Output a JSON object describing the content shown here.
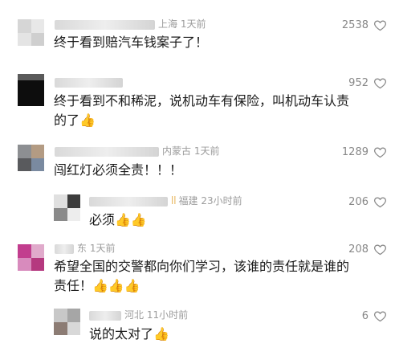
{
  "comments": [
    {
      "location": "上海",
      "time": "1天前",
      "text": [
        "终于看到赔汽车钱案子了！"
      ],
      "likes": "2538"
    },
    {
      "location": "",
      "time": "",
      "text": [
        "终于看到不和稀泥，说机动车有保险，叫机动车认责",
        "的了👍"
      ],
      "likes": "952"
    },
    {
      "location": "内蒙古",
      "time": "1天前",
      "text": [
        "闯红灯必须全责！！！"
      ],
      "likes": "1289"
    },
    {
      "location": "福建",
      "time": "23小时前",
      "text": [
        "必须👍👍"
      ],
      "likes": "206"
    },
    {
      "location": "东",
      "time": "1天前",
      "text": [
        "希望全国的交警都向你们学习，该谁的责任就是谁的",
        "责任！👍👍👍"
      ],
      "likes": "208"
    },
    {
      "location": "河北",
      "time": "11小时前",
      "text": [
        "说的太对了👍"
      ],
      "likes": "6"
    }
  ],
  "colors": {
    "meta": "#9c9c9c",
    "text": "#1a1a1a",
    "likes": "#888888"
  },
  "icons": {
    "like": "heart-outline-icon"
  }
}
